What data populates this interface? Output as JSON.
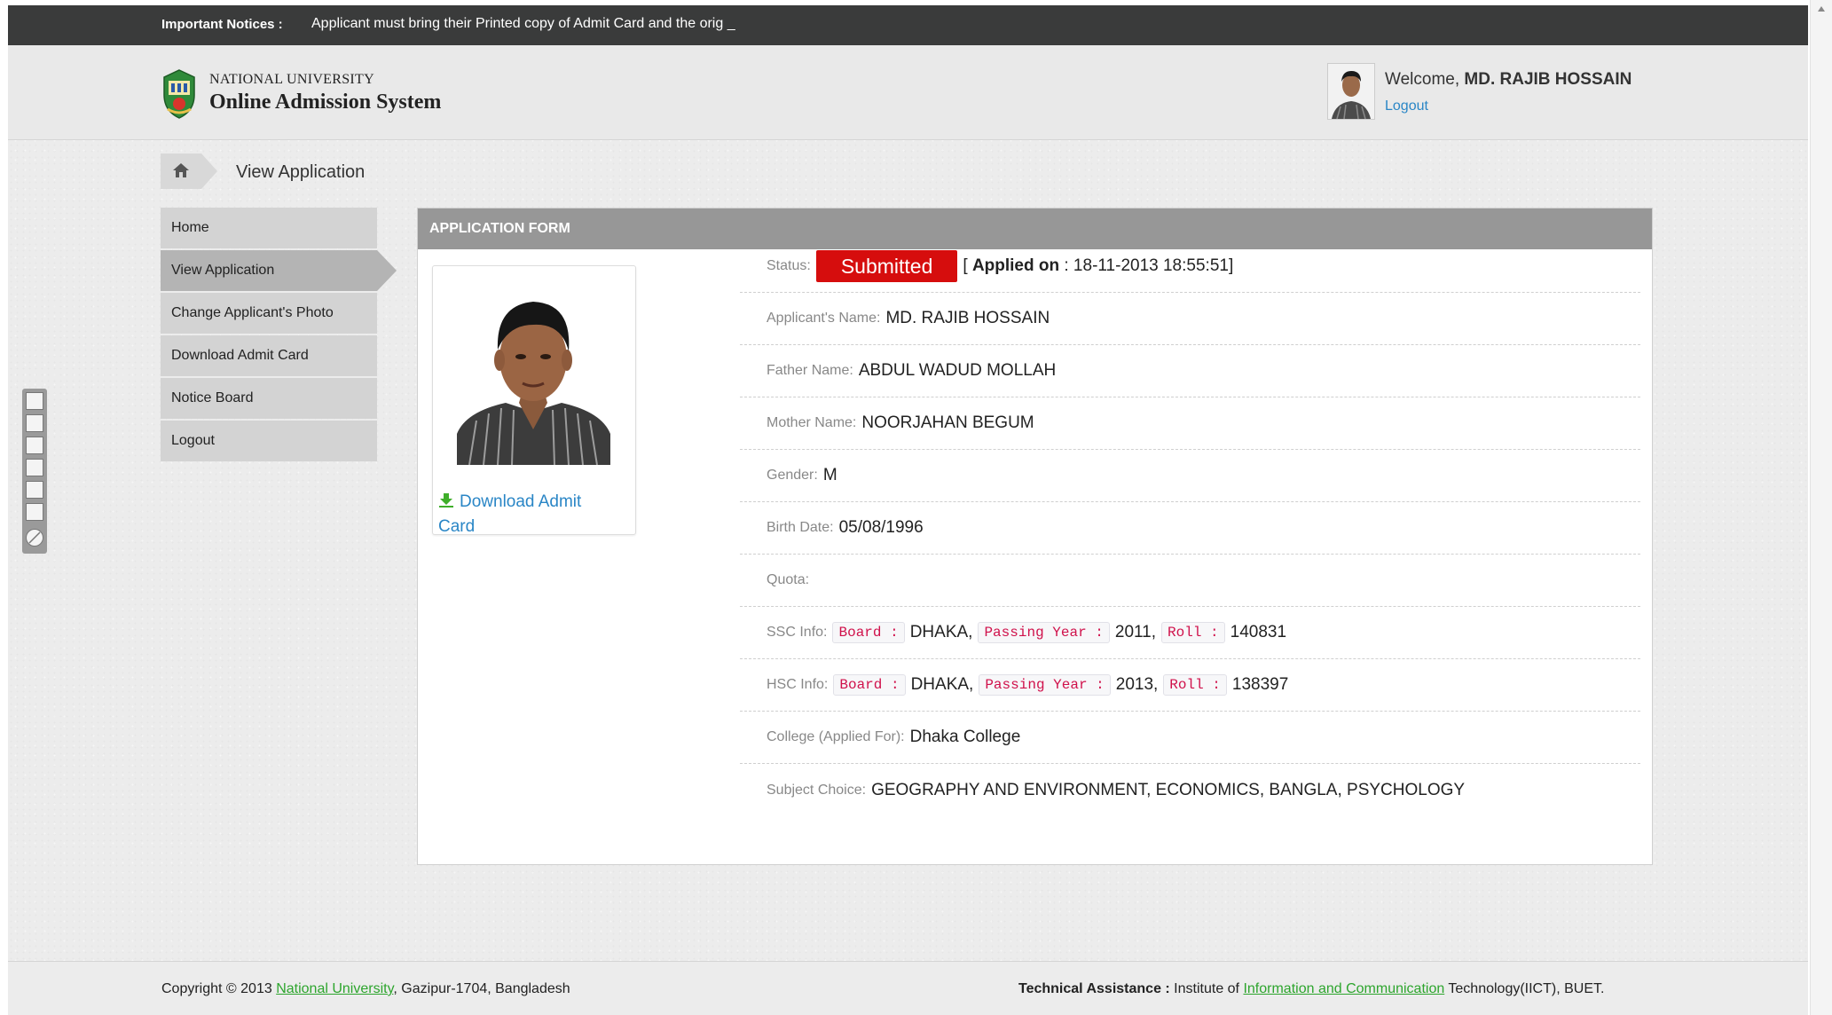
{
  "notice": {
    "label": "Important Notices :",
    "text": "Applicant must bring their Printed copy of Admit Card and the orig _"
  },
  "header": {
    "brand_top": "NATIONAL UNIVERSITY",
    "brand_main": "Online Admission System",
    "welcome_prefix": "Welcome, ",
    "user_name": "MD. RAJIB HOSSAIN",
    "logout": "Logout"
  },
  "breadcrumb": {
    "icon": "home-icon",
    "label": "View Application"
  },
  "sidebar": {
    "items": [
      {
        "label": "Home",
        "active": false
      },
      {
        "label": "View Application",
        "active": true
      },
      {
        "label": "Change Applicant's Photo",
        "active": false
      },
      {
        "label": "Download Admit Card",
        "active": false
      },
      {
        "label": "Notice Board",
        "active": false
      },
      {
        "label": "Logout",
        "active": false
      }
    ]
  },
  "panel": {
    "title": "APPLICATION FORM",
    "download_link": "Download Admit Card",
    "download_icon": "download-icon",
    "status": {
      "label": "Status:",
      "value": "Submitted",
      "applied_prefix": "[",
      "applied_label": "Applied on",
      "applied_value": ": 18-11-2013 18:55:51]"
    },
    "applicant_name": {
      "label": "Applicant's Name:",
      "value": "MD. RAJIB HOSSAIN"
    },
    "father_name": {
      "label": "Father Name:",
      "value": "ABDUL WADUD MOLLAH"
    },
    "mother_name": {
      "label": "Mother Name:",
      "value": "NOORJAHAN BEGUM"
    },
    "gender": {
      "label": "Gender:",
      "value": "M"
    },
    "birth_date": {
      "label": "Birth Date:",
      "value": "05/08/1996"
    },
    "quota": {
      "label": "Quota:",
      "value": ""
    },
    "ssc": {
      "label": "SSC Info:",
      "board_label": "Board :",
      "board": "DHAKA,",
      "year_label": "Passing Year :",
      "year": "2011,",
      "roll_label": "Roll :",
      "roll": "140831"
    },
    "hsc": {
      "label": "HSC Info:",
      "board_label": "Board :",
      "board": "DHAKA,",
      "year_label": "Passing Year :",
      "year": "2013,",
      "roll_label": "Roll :",
      "roll": "138397"
    },
    "college": {
      "label": "College (Applied For):",
      "value": "Dhaka College"
    },
    "subjects": {
      "label": "Subject Choice:",
      "value": "GEOGRAPHY AND ENVIRONMENT, ECONOMICS, BANGLA, PSYCHOLOGY"
    }
  },
  "footer": {
    "copyright_prefix": "Copyright © 2013 ",
    "university_link": "National University",
    "copyright_suffix": ", Gazipur-1704, Bangladesh",
    "tech_label": "Technical Assistance :",
    "tech_prefix": " Institute of ",
    "tech_link": "Information and Communication",
    "tech_suffix": " Technology(IICT), BUET."
  },
  "colors": {
    "status_red": "#d60d0d",
    "link_blue": "#2a86c6",
    "footer_link_green": "#2da52d",
    "notice_bar": "#3a3b3b",
    "panel_head": "#979797"
  }
}
